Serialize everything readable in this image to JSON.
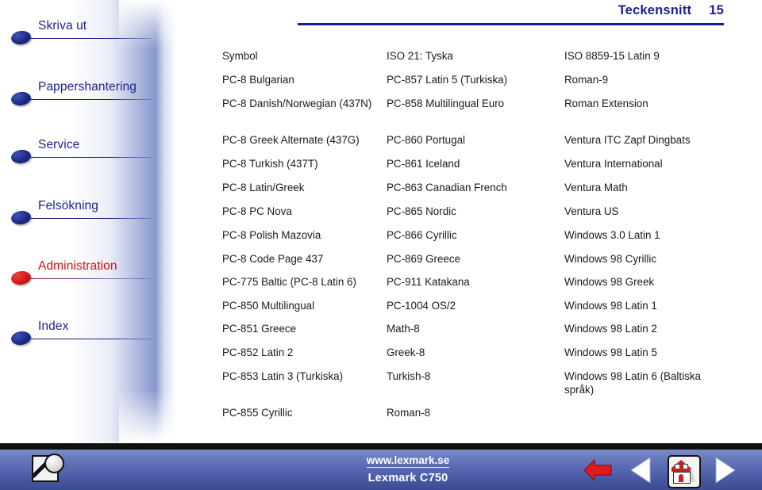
{
  "header": {
    "title": "Teckensnitt",
    "page_number": "15",
    "accent_color": "#1b1f8c"
  },
  "sidebar": {
    "items": [
      {
        "label": "Skriva ut",
        "state": "normal",
        "bullet": "bullet-icon",
        "color": "#1b1f8c"
      },
      {
        "label": "Pappershantering",
        "state": "normal",
        "bullet": "bullet-icon",
        "color": "#1b1f8c"
      },
      {
        "label": "Service",
        "state": "normal",
        "bullet": "bullet-icon",
        "color": "#1b1f8c"
      },
      {
        "label": "Felsökning",
        "state": "normal",
        "bullet": "bullet-icon",
        "color": "#1b1f8c"
      },
      {
        "label": "Administration",
        "state": "current",
        "bullet": "bullet-icon",
        "color": "#cc1111"
      },
      {
        "label": "Index",
        "state": "normal",
        "bullet": "bullet-icon",
        "color": "#1b1f8c"
      }
    ]
  },
  "table": {
    "rows": [
      {
        "c1": "Symbol",
        "c2": "ISO 21: Tyska",
        "c3": "ISO 8859-15 Latin 9"
      },
      {
        "c1": "PC-8 Bulgarian",
        "c2": "PC-857 Latin 5 (Turkiska)",
        "c3": "Roman-9"
      },
      {
        "c1": "PC-8 Danish/Norwegian (437N)",
        "c2": "PC-858 Multilingual Euro",
        "c3": "Roman Extension"
      },
      {
        "c1": "PC-8 Greek Alternate (437G)",
        "c2": "PC-860 Portugal",
        "c3": "Ventura ITC Zapf Dingbats"
      },
      {
        "c1": "PC-8 Turkish (437T)",
        "c2": "PC-861 Iceland",
        "c3": "Ventura International"
      },
      {
        "c1": "PC-8 Latin/Greek",
        "c2": "PC-863 Canadian French",
        "c3": "Ventura Math"
      },
      {
        "c1": "PC-8 PC Nova",
        "c2": "PC-865 Nordic",
        "c3": "Ventura US"
      },
      {
        "c1": "PC-8 Polish Mazovia",
        "c2": "PC-866 Cyrillic",
        "c3": "Windows 3.0 Latin 1"
      },
      {
        "c1": "PC-8 Code Page 437",
        "c2": "PC-869 Greece",
        "c3": "Windows 98 Cyrillic"
      },
      {
        "c1": "PC-775 Baltic (PC-8 Latin 6)",
        "c2": "PC-911 Katakana",
        "c3": "Windows 98 Greek"
      },
      {
        "c1": "PC-850 Multilingual",
        "c2": "PC-1004 OS/2",
        "c3": "Windows 98 Latin 1"
      },
      {
        "c1": "PC-851 Greece",
        "c2": "Math-8",
        "c3": "Windows 98 Latin 2"
      },
      {
        "c1": "PC-852 Latin 2",
        "c2": "Greek-8",
        "c3": "Windows 98 Latin 5"
      },
      {
        "c1": "PC-853 Latin 3 (Turkiska)",
        "c2": "Turkish-8",
        "c3": "Windows 98 Latin 6 (Baltiska språk)"
      },
      {
        "c1": "PC-855 Cyrillic",
        "c2": "Roman-8",
        "c3": ""
      }
    ]
  },
  "footer": {
    "url": "www.lexmark.se",
    "model": "Lexmark C750",
    "search_icon": "search-document-icon",
    "back_icon": "back-arrow-icon",
    "prev_icon": "previous-page-icon",
    "home_icon": "home-icon",
    "next_icon": "next-page-icon",
    "bar_color": "#4a5ca6",
    "back_arrow_color": "#e01b1b"
  }
}
